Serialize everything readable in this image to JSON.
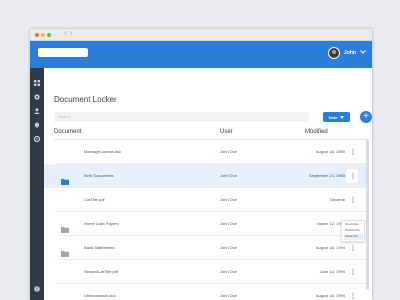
{
  "browser": {
    "nav_arrows": "‹ ›"
  },
  "header": {
    "user_name": "John"
  },
  "sidebar": {
    "icons": [
      "grid-icon",
      "gear-icon",
      "person-icon",
      "bell-icon",
      "settings-icon",
      "help-icon"
    ]
  },
  "main": {
    "title": "Document Locker",
    "search_placeholder": "Search",
    "sort_button_label": "Date",
    "add_button_label": "+",
    "columns": {
      "document": "Document",
      "user": "User",
      "modified": "Modified"
    }
  },
  "rows": [
    {
      "type": "file",
      "name": "MarriageLicense.doc",
      "user": "John Doe",
      "modified": "August 18, 1990"
    },
    {
      "type": "folder",
      "name": "Birth Documents",
      "user": "John Doe",
      "modified": "September 24, 1983"
    },
    {
      "type": "file",
      "name": "CarTitle.pdf",
      "user": "John Doe",
      "modified": "Decemb"
    },
    {
      "type": "folder",
      "name": "Home Loan Papers",
      "user": "John Doe",
      "modified": "March 12, 1996"
    },
    {
      "type": "folder",
      "name": "Bank Statements",
      "user": "John Doe",
      "modified": "August 18, 1994"
    },
    {
      "type": "file",
      "name": "SecondCarTitle.pdf",
      "user": "John Doe",
      "modified": "June 14, 1994"
    },
    {
      "type": "file",
      "name": "LifeInsurance.doc",
      "user": "John Doe",
      "modified": "August 18, 1994"
    }
  ],
  "context_menu": {
    "items": [
      "View Folder",
      "Rename File",
      "Delete File"
    ],
    "highlighted_index": 2
  },
  "colors": {
    "accent": "#2b7ed8",
    "sidebar": "#2f3b48",
    "row_highlight": "#e5f0fb",
    "folder": "#9aa6b2",
    "folder_active": "#2b7ed8"
  }
}
